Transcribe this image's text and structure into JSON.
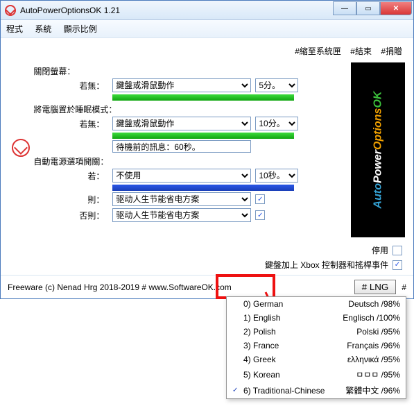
{
  "window": {
    "title": "AutoPowerOptionsOK 1.21"
  },
  "menu": {
    "program": "程式",
    "system": "系統",
    "ratio": "顯示比例"
  },
  "toplinks": {
    "shrink": "#縮至系統匣",
    "end": "#結束",
    "donate": "#捐贈"
  },
  "group1": {
    "label": "關閉螢幕：",
    "rowlabel": "若無：",
    "action": "鍵盤或滑鼠動作",
    "time": "5分。"
  },
  "group2": {
    "label": "將電腦置於睡眠模式：",
    "rowlabel": "若無：",
    "action": "鍵盤或滑鼠動作",
    "time": "10分。",
    "wait": "待機前的訊息：60秒。"
  },
  "group3": {
    "label": "自動電源選項開關：",
    "rowlabel": "若：",
    "action": "不使用",
    "time": "10秒。",
    "then": "則：",
    "thenval": "驱动人生节能省电方案",
    "else": "否則：",
    "elseval": "驱动人生节能省电方案"
  },
  "footer": {
    "disable": "停用",
    "xbox": "鍵盤加上 Xbox 控制器和搖桿事件"
  },
  "status": {
    "freeware": "Freeware (c) Nenad Hrg 2018-2019 # www.SoftwareOK.com",
    "lng": "# LNG",
    "hash": "#"
  },
  "logo": {
    "a": "Auto",
    "p": "Power",
    "o": "Options",
    "k": "OK"
  },
  "lang": {
    "items": [
      {
        "n": "0) German",
        "p": "Deutsch /98%",
        "ck": ""
      },
      {
        "n": "1) English",
        "p": "Englisch /100%",
        "ck": ""
      },
      {
        "n": "2) Polish",
        "p": "Polski /95%",
        "ck": ""
      },
      {
        "n": "3) France",
        "p": "Français /96%",
        "ck": ""
      },
      {
        "n": "4) Greek",
        "p": "ελληνικά /95%",
        "ck": ""
      },
      {
        "n": "5) Korean",
        "p": "ㅁㅁㅁ /95%",
        "ck": ""
      },
      {
        "n": "6) Traditional-Chinese",
        "p": "繁體中文 /96%",
        "ck": "✓"
      }
    ]
  }
}
